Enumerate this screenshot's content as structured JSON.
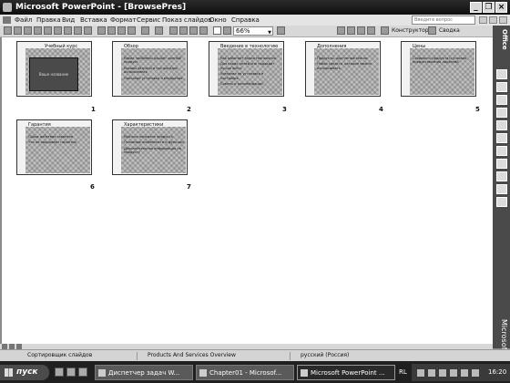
{
  "window": {
    "title": "Microsoft PowerPoint - [BrowsePres]",
    "minimize": "_",
    "restore": "❐",
    "close": "×"
  },
  "menu": {
    "items": [
      "Файл",
      "Правка",
      "Вид",
      "Вставка",
      "Формат",
      "Сервис",
      "Показ слайдов",
      "Окно",
      "Справка"
    ],
    "help_placeholder": "Введите вопрос"
  },
  "toolbar": {
    "zoom": "66%",
    "design_label": "Конструктор",
    "summary_label": "Сводка"
  },
  "slides": [
    {
      "number": "1",
      "title": "Учебный курс",
      "box_text": "Ваше название",
      "bullets": []
    },
    {
      "number": "2",
      "title": "Обзор",
      "bullets": [
        "Какие проблемы решает данный продукт",
        "Каковы затраты и как выгодно использовать",
        "Описание установки и внедрения"
      ]
    },
    {
      "number": "3",
      "title": "Введение в технологию",
      "bullets": [
        "Как работает новая технология",
        "Для каких целей она подходит лучше всего",
        "Указания по установке и настройке",
        "Советы и рекомендации"
      ]
    },
    {
      "number": "4",
      "title": "Дополнения",
      "bullets": [
        "Продукты, доступные сейчас",
        "Набор средств, которые можно использовать"
      ]
    },
    {
      "number": "5",
      "title": "Цены",
      "bullets": [
        "Стоимость продукта и условия предоставления лицензий"
      ]
    },
    {
      "number": "6",
      "title": "Гарантия",
      "bullets": [
        "Сроки действия гарантии",
        "Что не покрывает гарантия"
      ]
    },
    {
      "number": "7",
      "title": "Характеристики",
      "bullets": [
        "Краткое описание продукта",
        "Основные особенности и функции",
        "Дополнительная информация по продукту"
      ]
    }
  ],
  "status": {
    "view": "Сортировщик слайдов",
    "design": "Products And Services Overview",
    "language": "русский (Россия)"
  },
  "taskbar": {
    "start_label": "пуск",
    "tasks": [
      "Диспетчер задач W...",
      "Chapter01 - Microsof...",
      "Microsoft PowerPoint ..."
    ],
    "language": "RL",
    "clock": "16:20"
  },
  "taskpane": {
    "top_label": "Office",
    "bottom_label": "Microsoft"
  }
}
